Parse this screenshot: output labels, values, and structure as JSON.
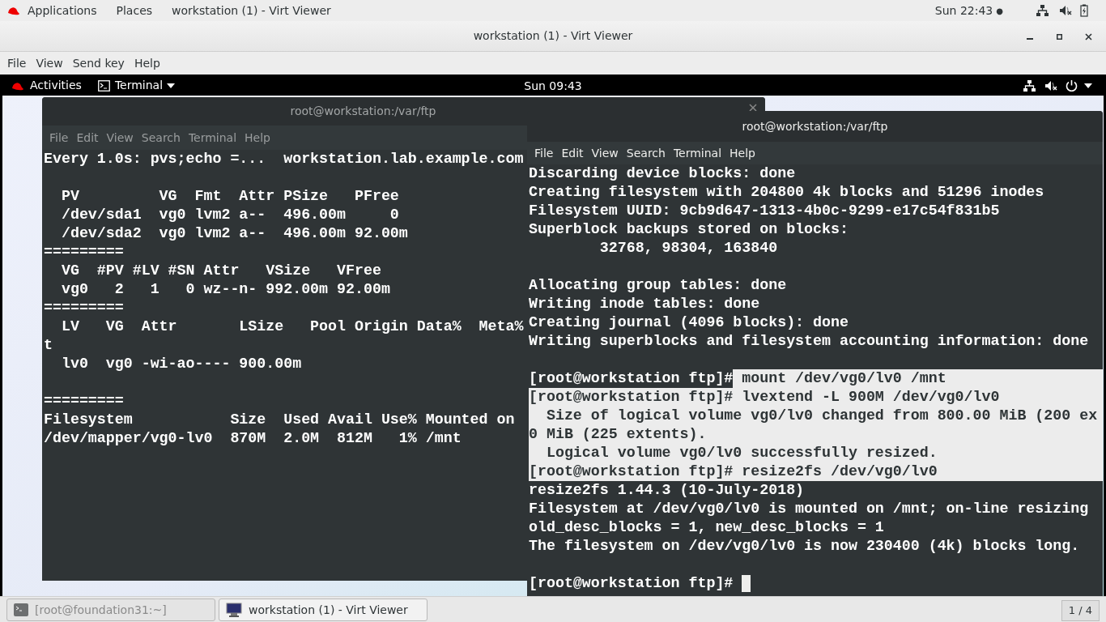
{
  "host_top_bar": {
    "items": [
      {
        "label": "Applications"
      },
      {
        "label": "Places"
      },
      {
        "label": "workstation (1) - Virt Viewer"
      }
    ],
    "clock": "Sun 22:43",
    "clock_dot": "●"
  },
  "window": {
    "title": "workstation (1) - Virt Viewer"
  },
  "menu": [
    "File",
    "View",
    "Send key",
    "Help"
  ],
  "guest_top_bar": {
    "activities": "Activities",
    "app_menu": "Terminal",
    "clock": "Sun 09:43"
  },
  "terminals": [
    {
      "title": "root@workstation:/var/ftp",
      "active": false,
      "menu": [
        "File",
        "Edit",
        "View",
        "Search",
        "Terminal",
        "Help"
      ],
      "lines": [
        {
          "text": "Every 1.0s: pvs;echo =...  workstation.lab.example.com",
          "selected": false
        },
        {
          "text": "  PV         VG  Fmt  Attr PSize   PFree",
          "selected": false,
          "blank_before": true
        },
        {
          "text": "  /dev/sda1  vg0 lvm2 a--  496.00m     0",
          "selected": false
        },
        {
          "text": "  /dev/sda2  vg0 lvm2 a--  496.00m 92.00m",
          "selected": false
        },
        {
          "text": "=========",
          "selected": false
        },
        {
          "text": "  VG  #PV #LV #SN Attr   VSize   VFree",
          "selected": false
        },
        {
          "text": "  vg0   2   1   0 wz--n- 992.00m 92.00m",
          "selected": false
        },
        {
          "text": "=========",
          "selected": false
        },
        {
          "text": "  LV   VG  Attr       LSize   Pool Origin Data%  Meta%",
          "selected": false
        },
        {
          "text": "t",
          "selected": false
        },
        {
          "text": "  lv0  vg0 -wi-ao---- 900.00m",
          "selected": false
        },
        {
          "text": "=========",
          "selected": false,
          "blank_before": true
        },
        {
          "text": "Filesystem           Size  Used Avail Use% Mounted on",
          "selected": false
        },
        {
          "text": "/dev/mapper/vg0-lv0  870M  2.0M  812M   1% /mnt",
          "selected": false
        }
      ]
    },
    {
      "title": "root@workstation:/var/ftp",
      "active": true,
      "menu": [
        "File",
        "Edit",
        "View",
        "Search",
        "Terminal",
        "Help"
      ],
      "lines": [
        {
          "text": "Discarding device blocks: done",
          "selected": false
        },
        {
          "text": "Creating filesystem with 204800 4k blocks and 51296 inodes",
          "selected": false
        },
        {
          "text": "Filesystem UUID: 9cb9d647-1313-4b0c-9299-e17c54f831b5",
          "selected": false
        },
        {
          "text": "Superblock backups stored on blocks:",
          "selected": false
        },
        {
          "text": "        32768, 98304, 163840",
          "selected": false
        },
        {
          "text": "Allocating group tables: done",
          "selected": false,
          "blank_before": true
        },
        {
          "text": "Writing inode tables: done",
          "selected": false
        },
        {
          "text": "Creating journal (4096 blocks): done",
          "selected": false
        },
        {
          "text": "Writing superblocks and filesystem accounting information: done",
          "selected": false
        },
        {
          "prefix": "[root@workstation ftp]#",
          "text": " mount /dev/vg0/lv0 /mnt",
          "selected": true,
          "blank_before": true
        },
        {
          "text": "[root@workstation ftp]# lvextend -L 900M /dev/vg0/lv0",
          "selected": true
        },
        {
          "text": "  Size of logical volume vg0/lv0 changed from 800.00 MiB (200 ex",
          "selected": true
        },
        {
          "text": "0 MiB (225 extents).",
          "selected": true
        },
        {
          "text": "  Logical volume vg0/lv0 successfully resized.",
          "selected": true
        },
        {
          "text": "[root@workstation ftp]# resize2fs /dev/vg0/lv0",
          "selected": true
        },
        {
          "text": "resize2fs 1.44.3 (10-July-2018)",
          "selected": false
        },
        {
          "text": "Filesystem at /dev/vg0/lv0 is mounted on /mnt; on-line resizing",
          "selected": false
        },
        {
          "text": "old_desc_blocks = 1, new_desc_blocks = 1",
          "selected": false
        },
        {
          "text": "The filesystem on /dev/vg0/lv0 is now 230400 (4k) blocks long.",
          "selected": false
        },
        {
          "text": "[root@workstation ftp]# ",
          "selected": false,
          "blank_before": true,
          "cursor": true
        }
      ]
    }
  ],
  "taskbar": {
    "items": [
      {
        "kind": "terminal",
        "label": "[root@foundation31:~]",
        "selected": false
      },
      {
        "kind": "viewer",
        "label": "workstation (1) - Virt Viewer",
        "selected": true
      }
    ],
    "workspace": "1 / 4"
  }
}
